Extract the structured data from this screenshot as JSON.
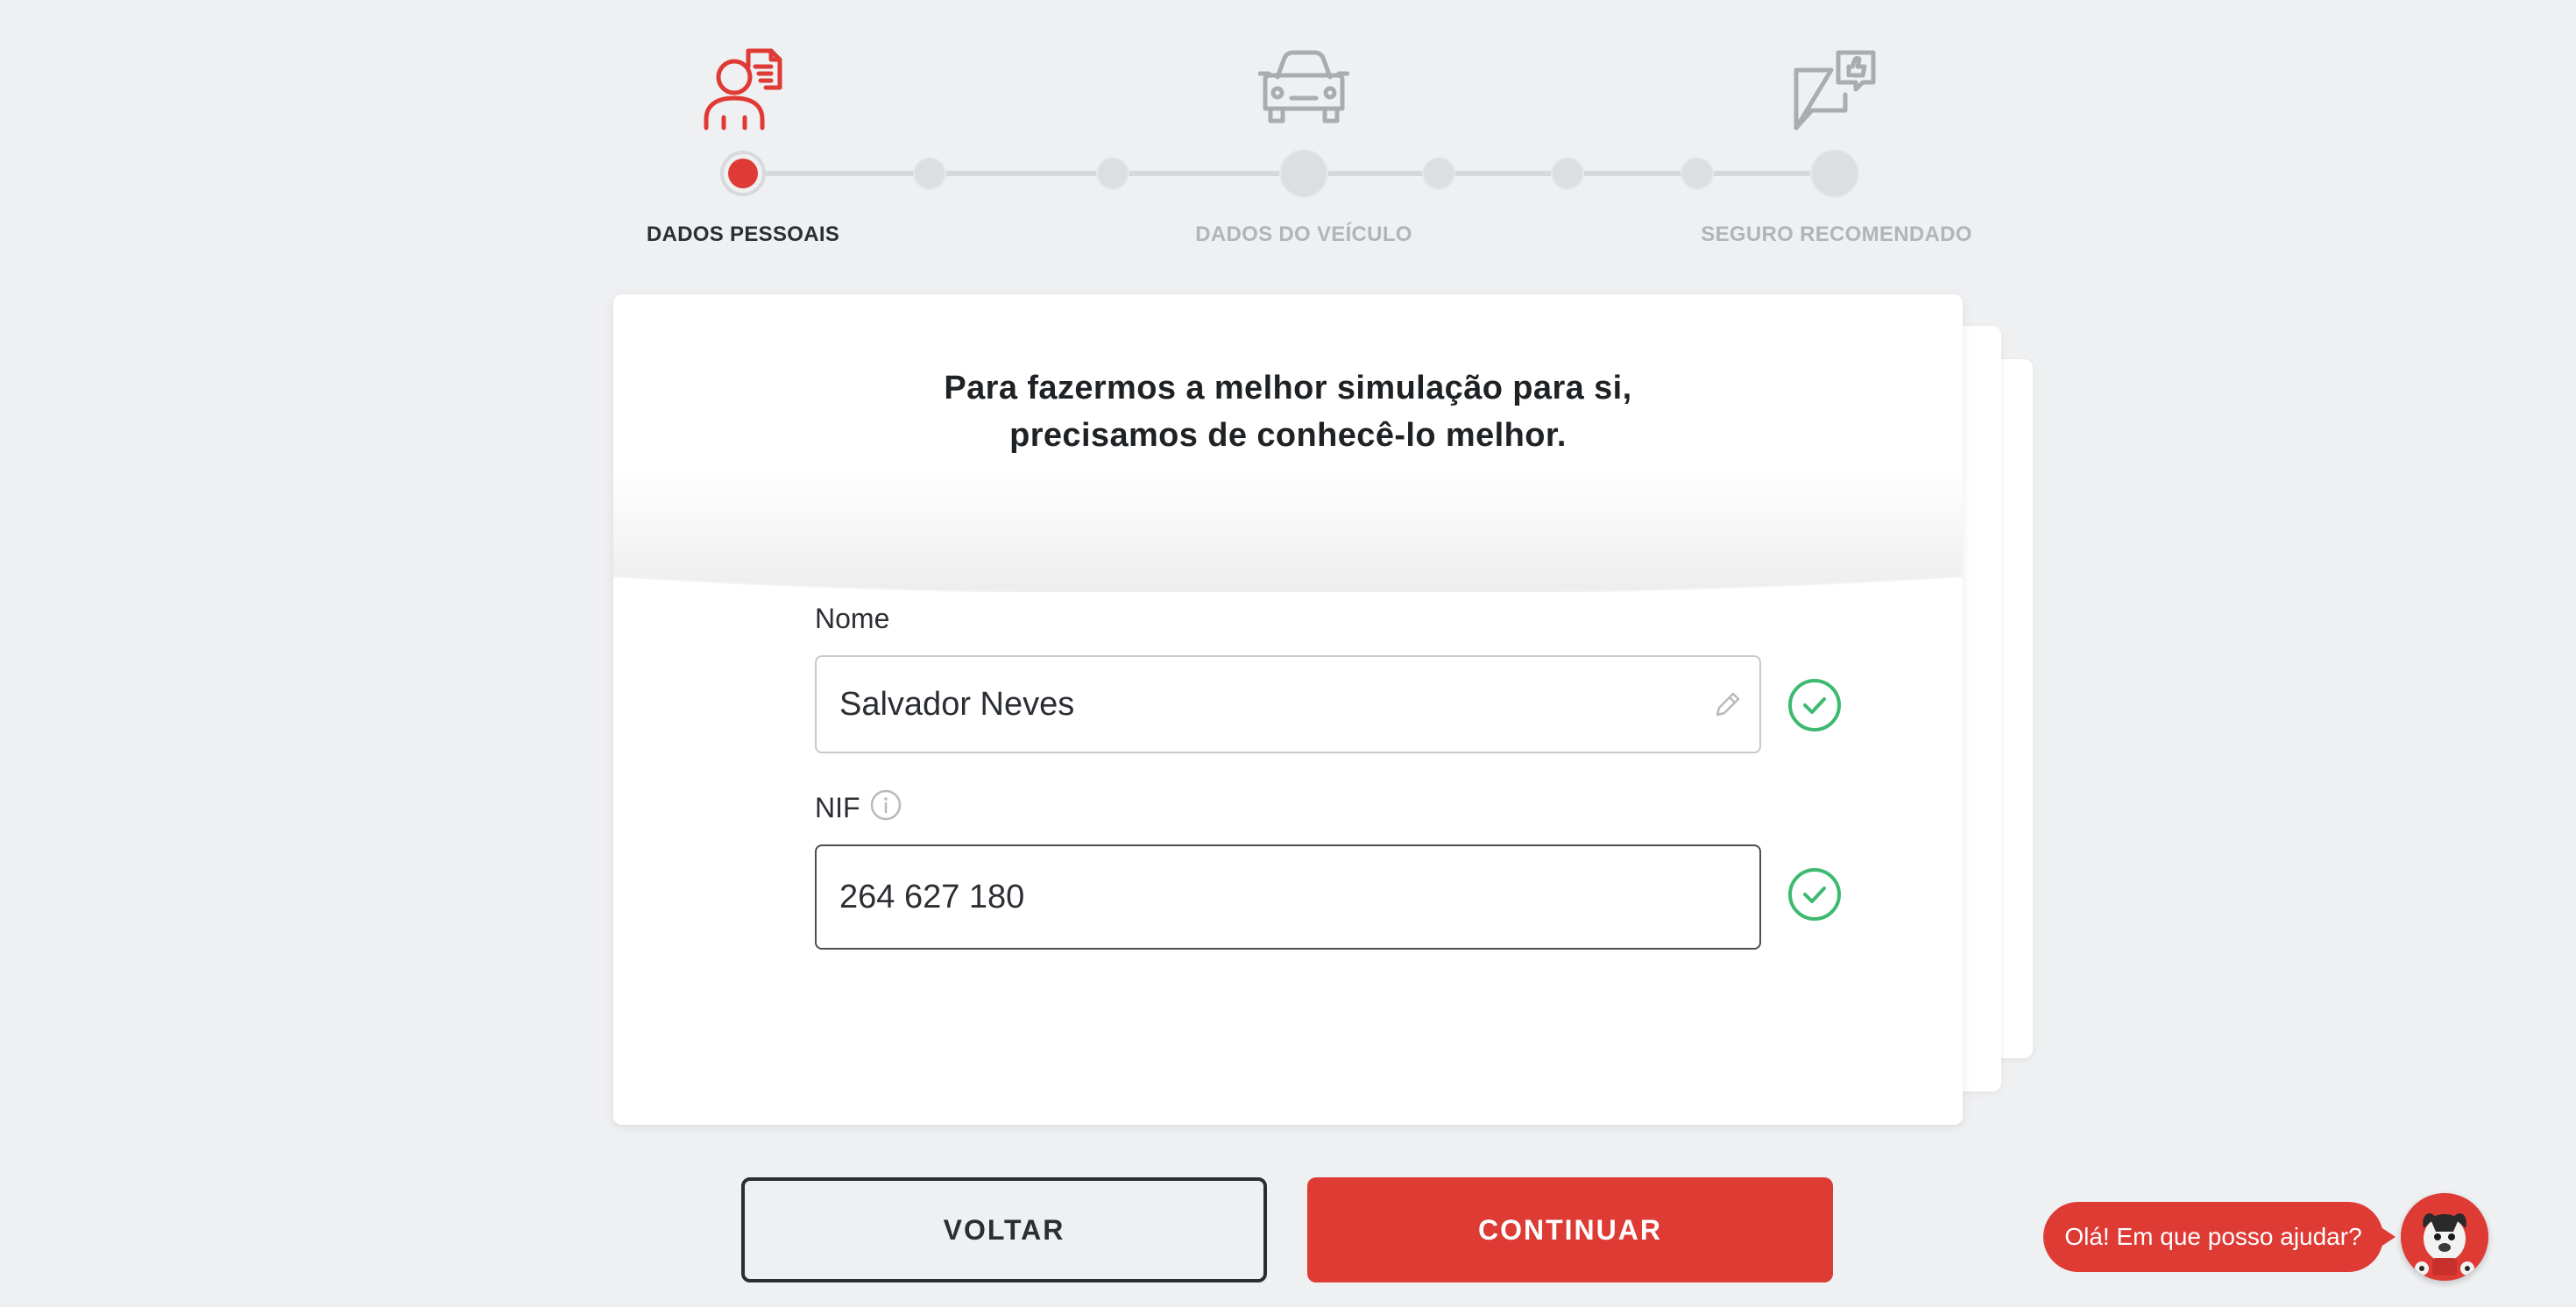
{
  "stepper": {
    "steps": [
      {
        "label": "DADOS PESSOAIS",
        "icon": "person-document-icon",
        "state": "current"
      },
      {
        "label": "DADOS DO VEÍCULO",
        "icon": "car-icon",
        "state": "upcoming"
      },
      {
        "label": "SEGURO RECOMENDADO",
        "icon": "thumbs-up-chat-icon",
        "state": "upcoming"
      }
    ],
    "progress_dots": 8,
    "active_dot": 1
  },
  "card": {
    "title_line1": "Para fazermos a melhor simulação para si,",
    "title_line2": "precisamos de conhecê-lo melhor."
  },
  "form": {
    "name": {
      "label": "Nome",
      "value": "Salvador Neves",
      "valid": true
    },
    "nif": {
      "label": "NIF",
      "value": "264 627 180",
      "valid": true
    }
  },
  "actions": {
    "back_label": "VOLTAR",
    "continue_label": "CONTINUAR"
  },
  "chat": {
    "greeting": "Olá! Em que posso ajudar?"
  },
  "colors": {
    "brand_red": "#de3b35",
    "success_green": "#3dba6f",
    "background": "#eff0f2",
    "muted_text": "#b1b4b8"
  }
}
